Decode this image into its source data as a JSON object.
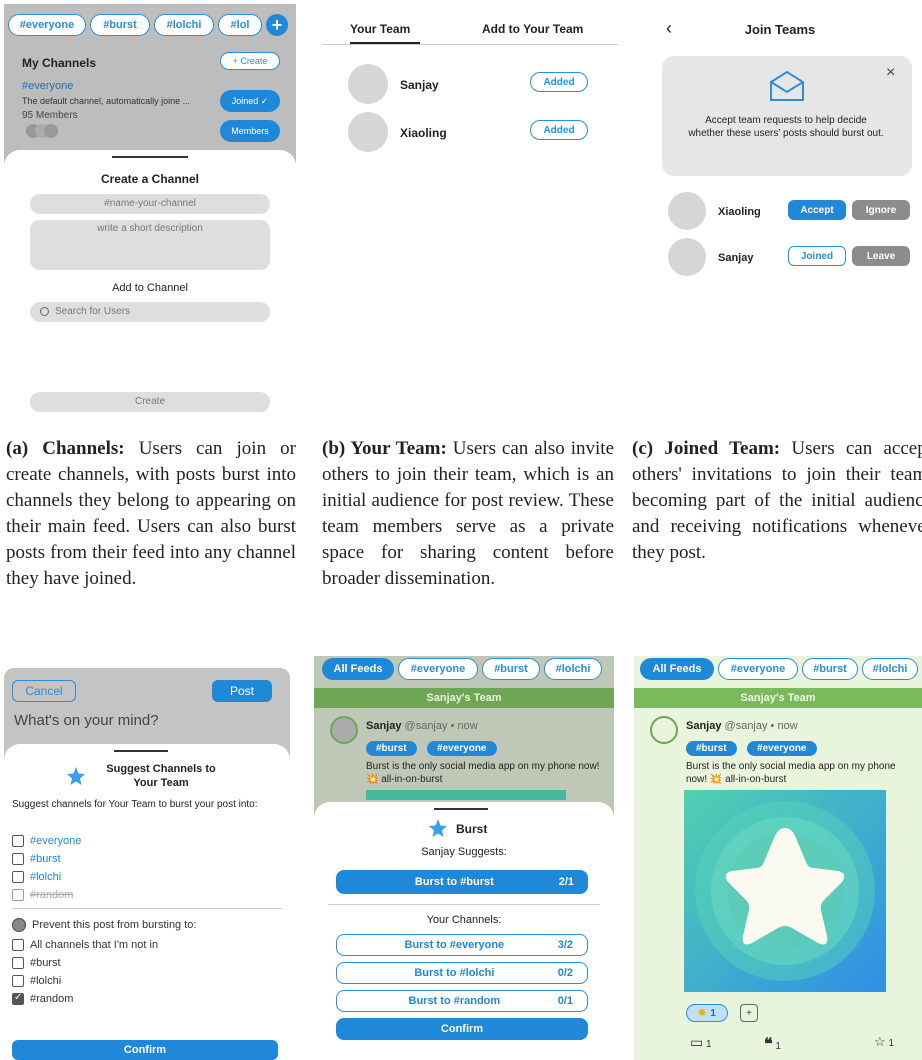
{
  "a": {
    "tabs": [
      "#everyone",
      "#burst",
      "#lolchi",
      "#lol"
    ],
    "my_channels": "My Channels",
    "create": "+ Create",
    "channel_name": "#everyone",
    "channel_desc": "The default channel, automatically joine ...",
    "members_count": "95 Members",
    "joined": "Joined ✓",
    "members": "Members",
    "sheet_title": "Create a Channel",
    "name_placeholder": "#name-your-channel",
    "desc_placeholder": "write a short description",
    "add_to_channel": "Add to Channel",
    "search_placeholder": "Search for Users",
    "create_button": "Create"
  },
  "b": {
    "tab_your_team": "Your Team",
    "tab_add": "Add to Your Team",
    "rows": [
      {
        "name": "Sanjay",
        "status": "Added"
      },
      {
        "name": "Xiaoling",
        "status": "Added"
      }
    ]
  },
  "c": {
    "title": "Join Teams",
    "notice": "Accept team requests to help decide whether these users' posts should burst out.",
    "row1_name": "Xiaoling",
    "accept": "Accept",
    "ignore": "Ignore",
    "row2_name": "Sanjay",
    "joined": "Joined",
    "leave": "Leave"
  },
  "d": {
    "cancel": "Cancel",
    "post": "Post",
    "placeholder": "What's on your mind?",
    "title": "Suggest Channels to Your Team",
    "prompt": "Suggest channels for Your Team to burst your post into:",
    "suggest": [
      "#everyone",
      "#burst",
      "#lolchi",
      "#random"
    ],
    "prevent_title": "Prevent this post from bursting to:",
    "prevent": [
      "All channels that I'm not in",
      "#burst",
      "#lolchi",
      "#random"
    ],
    "confirm": "Confirm"
  },
  "e": {
    "tabs": [
      "All Feeds",
      "#everyone",
      "#burst",
      "#lolchi"
    ],
    "team_banner": "Sanjay's Team",
    "author": "Sanjay",
    "handle": "@sanjay • now",
    "tags": [
      "#burst",
      "#everyone"
    ],
    "body": "Burst is the only social media app on my phone now! 💥 all-in-on-burst",
    "sheet_title": "Burst",
    "suggests_label": "Sanjay Suggests:",
    "suggest_btn": "Burst to #burst",
    "suggest_count": "2/1",
    "your_channels": "Your Channels:",
    "channels": [
      {
        "label": "Burst to #everyone",
        "count": "3/2"
      },
      {
        "label": "Burst to #lolchi",
        "count": "0/2"
      },
      {
        "label": "Burst to #random",
        "count": "0/1"
      }
    ],
    "confirm": "Confirm"
  },
  "f": {
    "tabs": [
      "All Feeds",
      "#everyone",
      "#burst",
      "#lolchi"
    ],
    "team_banner": "Sanjay's Team",
    "author": "Sanjay",
    "handle": "@sanjay • now",
    "tags": [
      "#burst",
      "#everyone"
    ],
    "body": "Burst is the only social media app on my phone now! 💥 all-in-on-burst",
    "reaction_count": "1",
    "comments": "1",
    "quotes": "1",
    "stars": "1"
  },
  "captions": {
    "a_label": "(a) Channels:",
    "a_text": " Users can join or create channels, with posts burst into channels they belong to appearing on their main feed. Users can also burst posts from their feed into any channel they have joined.",
    "b_label": "(b) Your Team:",
    "b_text": " Users can also invite others to join their team, which is an initial audience for post review. These team members serve as a private space for sharing content before broader dissemination.",
    "c_label": "(c) Joined Team:",
    "c_text": " Users can accept others' invitations to join their team, becoming part of the initial audience and receiving notifications whenever they post."
  },
  "colors": {
    "blue": "#1f88d9",
    "green": "#74b35a",
    "light_green": "#e8f4dc"
  }
}
